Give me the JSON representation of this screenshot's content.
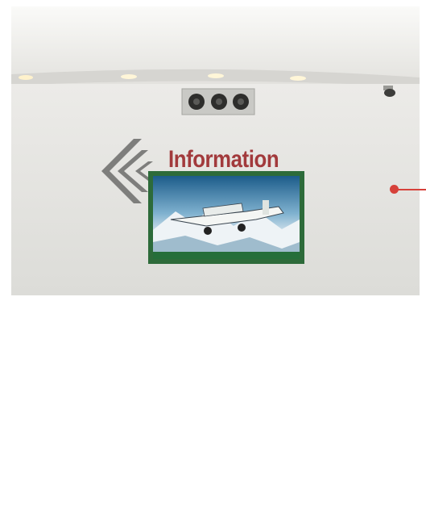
{
  "sign": {
    "text": "Information",
    "color": "#a23a3c"
  },
  "screen": {
    "caption": "",
    "frame_color": "#2d6b3a"
  },
  "flags": [
    {
      "name": "washington-state-flag",
      "color": "#2e6b3c"
    },
    {
      "name": "us-flag",
      "stripe_red": "#b8323a",
      "canton_blue": "#2b3a78"
    }
  ],
  "callout": {
    "color": "#d6413a"
  },
  "colors": {
    "wall": "#e7e7e4",
    "ceiling": "#f2f1ee",
    "desk": "#5f5f5d",
    "floor": "#bdb3a2",
    "logo": "#7e7e7c"
  }
}
